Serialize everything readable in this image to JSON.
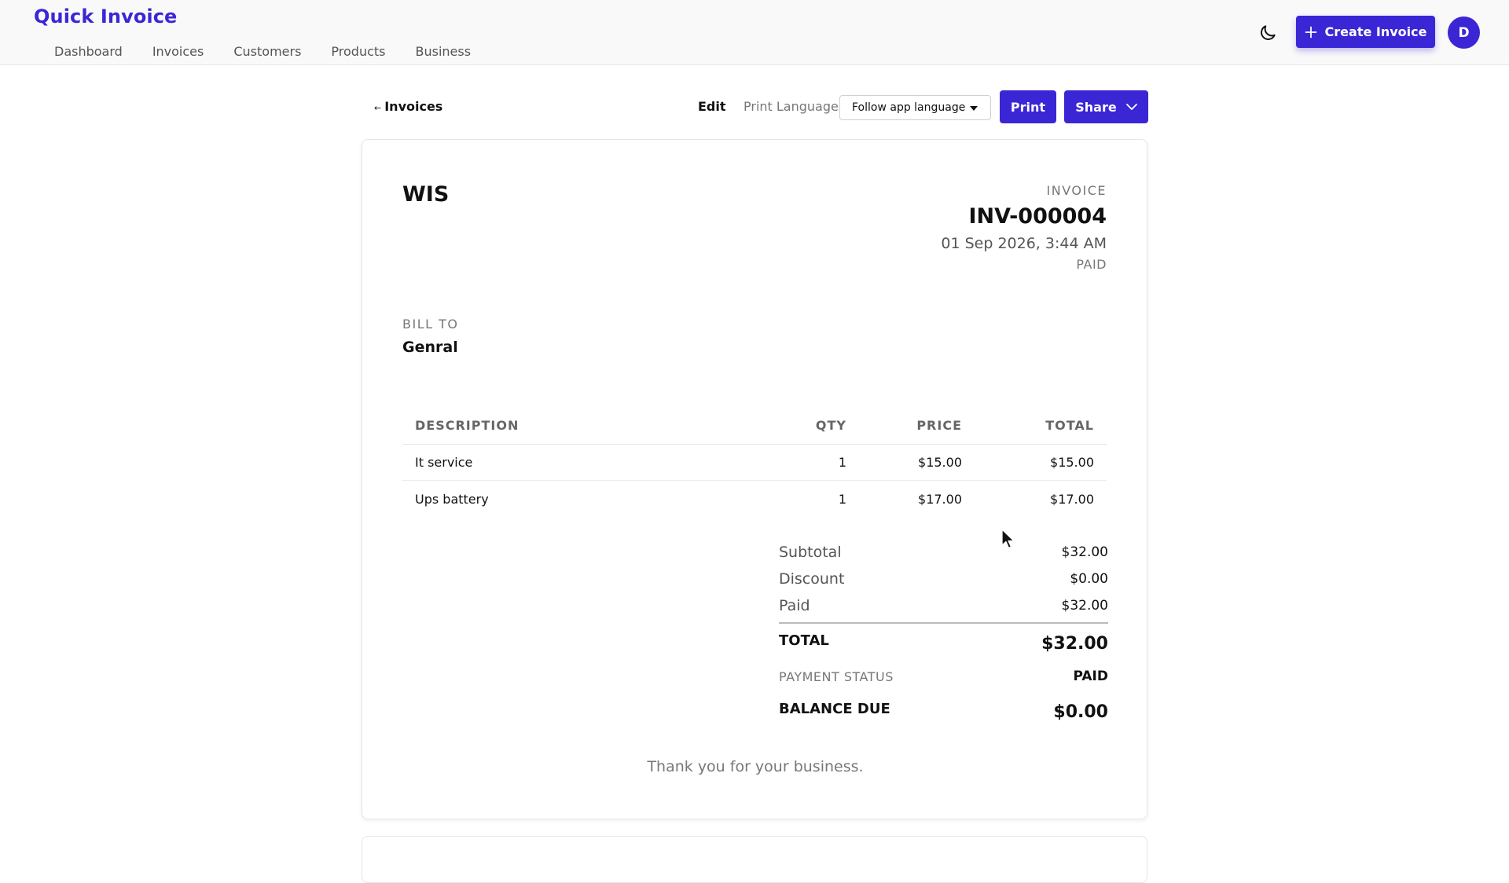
{
  "app": {
    "title": "Quick Invoice",
    "avatar_initial": "D"
  },
  "nav": [
    "Dashboard",
    "Invoices",
    "Customers",
    "Products",
    "Business"
  ],
  "header": {
    "create_label": "Create Invoice"
  },
  "toolbar": {
    "back_label": "Invoices",
    "back_arrow": "←",
    "edit_label": "Edit",
    "print_language_label": "Print Language:",
    "print_language_value": "Follow app language",
    "print_label": "Print",
    "share_label": "Share"
  },
  "invoice": {
    "business_name": "WIS",
    "label": "INVOICE",
    "number": "INV-000004",
    "date": "01 Sep 2026, 3:44 AM",
    "status": "PAID",
    "bill_to_label": "BILL TO",
    "customer": "Genral",
    "columns": {
      "description": "DESCRIPTION",
      "qty": "QTY",
      "price": "PRICE",
      "total": "TOTAL"
    },
    "items": [
      {
        "description": "It service",
        "qty": "1",
        "price": "$15.00",
        "total": "$15.00"
      },
      {
        "description": "Ups battery",
        "qty": "1",
        "price": "$17.00",
        "total": "$17.00"
      }
    ],
    "summary": {
      "subtotal_label": "Subtotal",
      "subtotal": "$32.00",
      "discount_label": "Discount",
      "discount": "$0.00",
      "paid_label": "Paid",
      "paid": "$32.00",
      "total_label": "TOTAL",
      "total": "$32.00",
      "payment_status_label": "PAYMENT STATUS",
      "payment_status": "PAID",
      "balance_label": "BALANCE DUE",
      "balance": "$0.00"
    },
    "footer_note": "Thank you for your business."
  },
  "colors": {
    "accent": "#3b26d6",
    "muted": "#777777",
    "text": "#111111"
  },
  "icons": {
    "theme": "moon-icon",
    "create": "plus-icon",
    "share": "chevron-down-icon",
    "select": "caret-down-icon"
  }
}
